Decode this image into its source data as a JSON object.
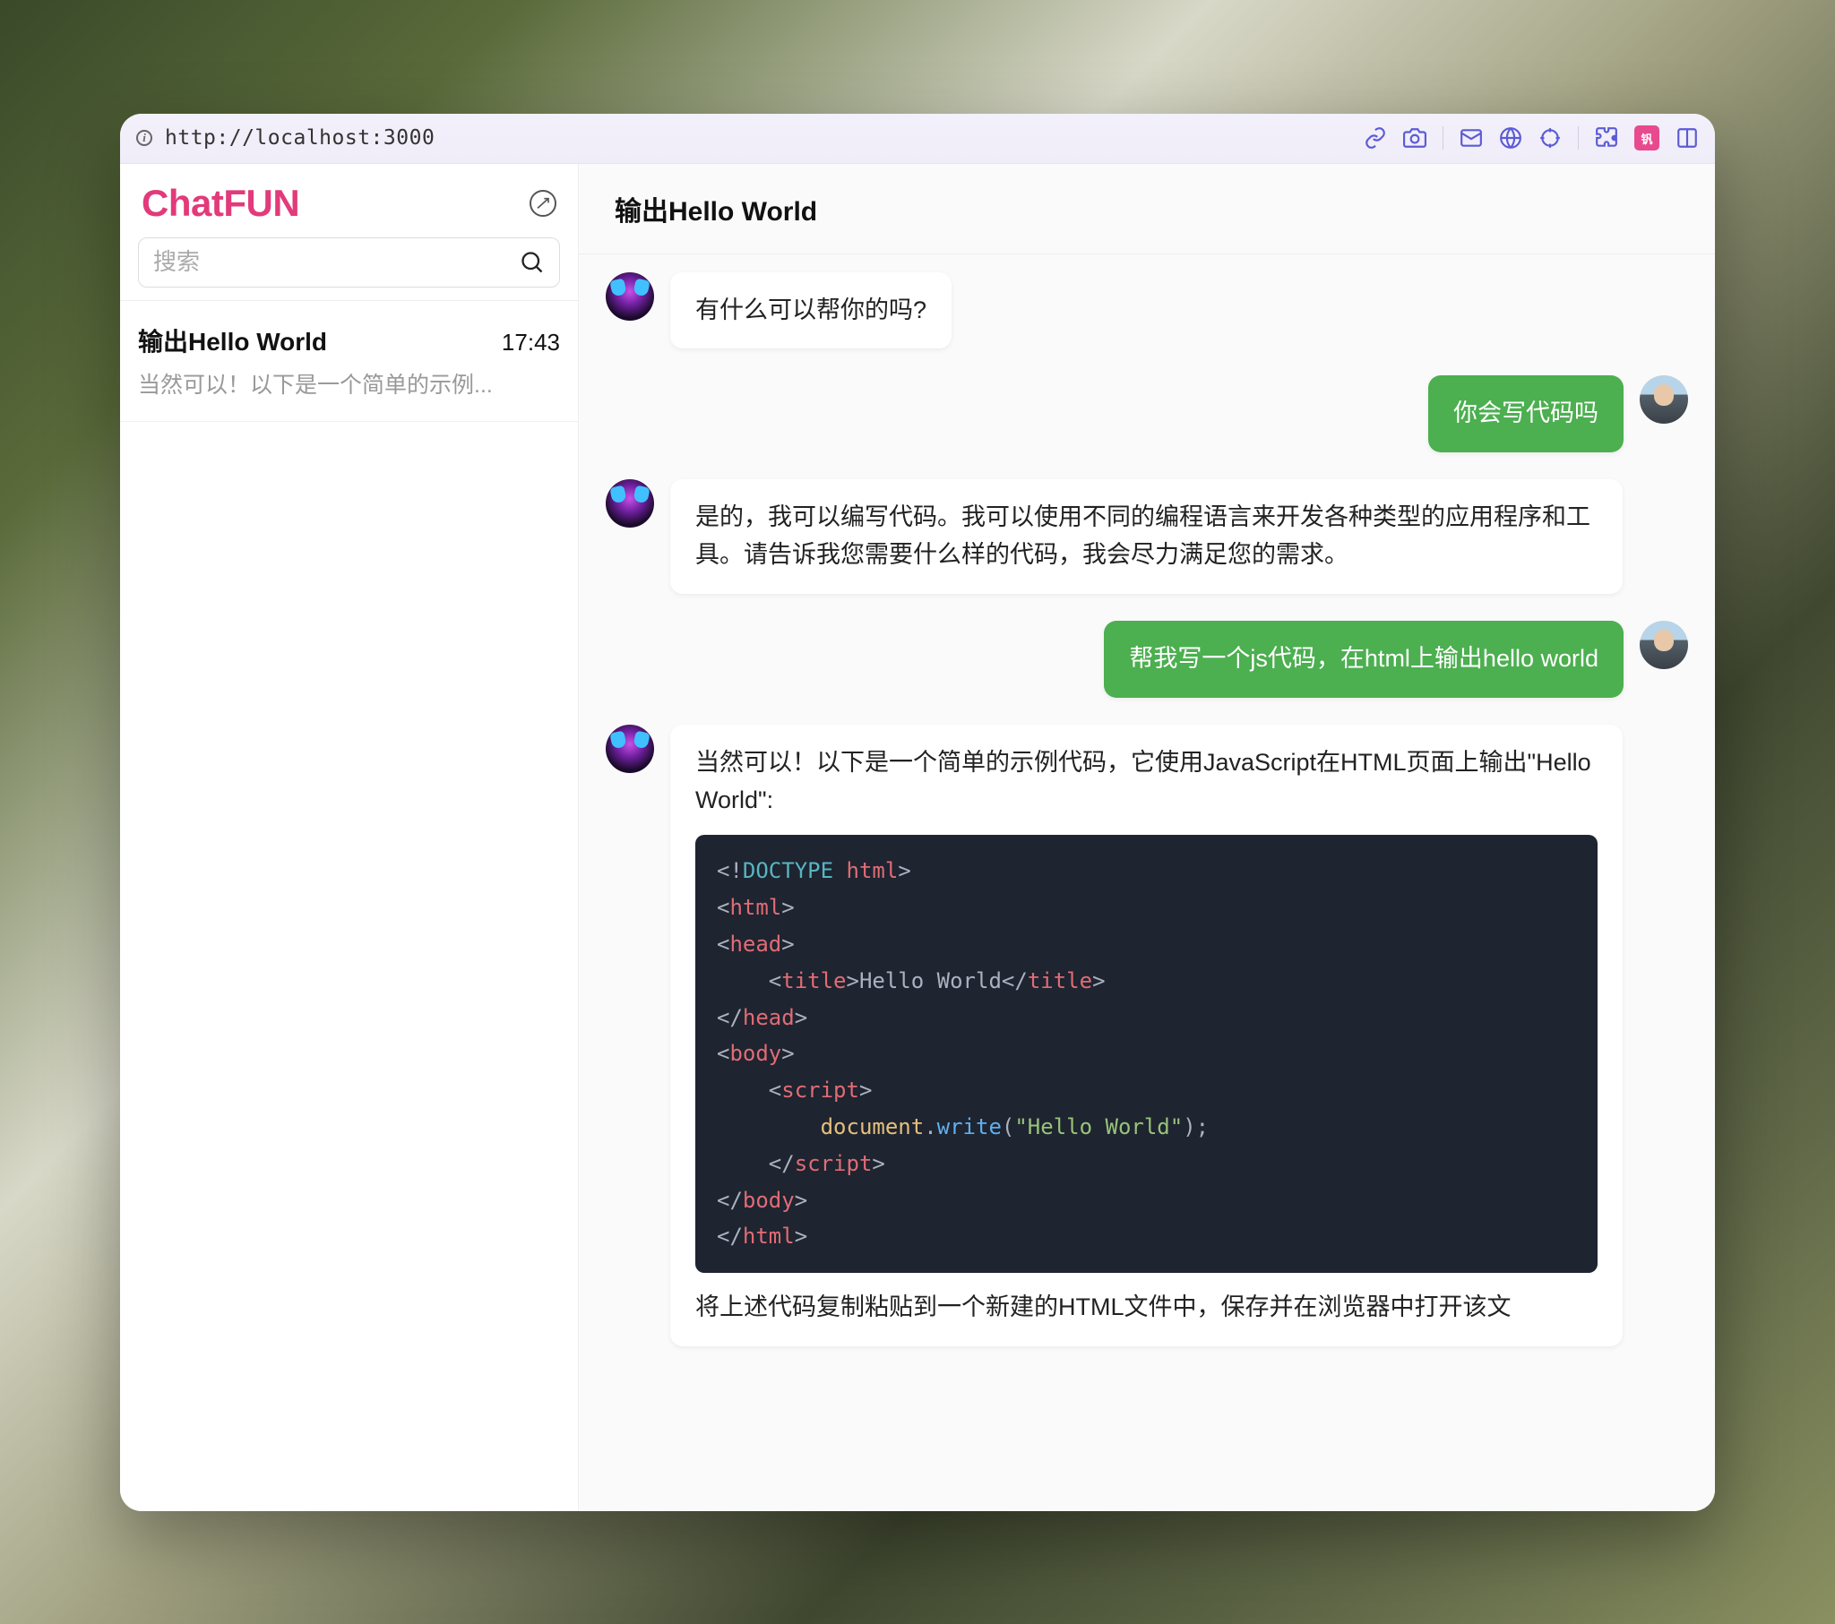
{
  "addressbar": {
    "url": "http://localhost:3000"
  },
  "sidebar": {
    "logo": "ChatFUN",
    "search_placeholder": "搜索",
    "conversations": [
      {
        "title": "输出Hello World",
        "time": "17:43",
        "preview": "当然可以！以下是一个简单的示例..."
      }
    ]
  },
  "chat": {
    "title": "输出Hello World",
    "messages": [
      {
        "role": "bot",
        "text": "有什么可以帮你的吗?"
      },
      {
        "role": "user",
        "text": "你会写代码吗"
      },
      {
        "role": "bot",
        "text": "是的，我可以编写代码。我可以使用不同的编程语言来开发各种类型的应用程序和工具。请告诉我您需要什么样的代码，我会尽力满足您的需求。"
      },
      {
        "role": "user",
        "text": "帮我写一个js代码，在html上输出hello world"
      },
      {
        "role": "bot",
        "intro": "当然可以！以下是一个简单的示例代码，它使用JavaScript在HTML页面上输出\"Hello World\":",
        "code": {
          "lines": [
            {
              "indent": 0,
              "tokens": [
                [
                  "<!",
                  "punct"
                ],
                [
                  "DOCTYPE",
                  "doctype"
                ],
                [
                  " ",
                  "punct"
                ],
                [
                  "html",
                  "tag"
                ],
                [
                  ">",
                  "punct"
                ]
              ]
            },
            {
              "indent": 0,
              "tokens": [
                [
                  "<",
                  "punct"
                ],
                [
                  "html",
                  "tag"
                ],
                [
                  ">",
                  "punct"
                ]
              ]
            },
            {
              "indent": 0,
              "tokens": [
                [
                  "<",
                  "punct"
                ],
                [
                  "head",
                  "tag"
                ],
                [
                  ">",
                  "punct"
                ]
              ]
            },
            {
              "indent": 1,
              "tokens": [
                [
                  "<",
                  "punct"
                ],
                [
                  "title",
                  "tag"
                ],
                [
                  ">",
                  "punct"
                ],
                [
                  "Hello World",
                  "text"
                ],
                [
                  "</",
                  "punct"
                ],
                [
                  "title",
                  "tag"
                ],
                [
                  ">",
                  "punct"
                ]
              ]
            },
            {
              "indent": 0,
              "tokens": [
                [
                  "</",
                  "punct"
                ],
                [
                  "head",
                  "tag"
                ],
                [
                  ">",
                  "punct"
                ]
              ]
            },
            {
              "indent": 0,
              "tokens": [
                [
                  "<",
                  "punct"
                ],
                [
                  "body",
                  "tag"
                ],
                [
                  ">",
                  "punct"
                ]
              ]
            },
            {
              "indent": 1,
              "tokens": [
                [
                  "<",
                  "punct"
                ],
                [
                  "script",
                  "tag"
                ],
                [
                  ">",
                  "punct"
                ]
              ]
            },
            {
              "indent": 2,
              "tokens": [
                [
                  "document",
                  "obj"
                ],
                [
                  ".",
                  "punct"
                ],
                [
                  "write",
                  "method"
                ],
                [
                  "(",
                  "punct"
                ],
                [
                  "\"Hello World\"",
                  "string"
                ],
                [
                  ")",
                  "punct"
                ],
                [
                  ";",
                  "punct"
                ]
              ]
            },
            {
              "indent": 1,
              "tokens": [
                [
                  "</",
                  "punct"
                ],
                [
                  "script",
                  "tag"
                ],
                [
                  ">",
                  "punct"
                ]
              ]
            },
            {
              "indent": 0,
              "tokens": [
                [
                  "</",
                  "punct"
                ],
                [
                  "body",
                  "tag"
                ],
                [
                  ">",
                  "punct"
                ]
              ]
            },
            {
              "indent": 0,
              "tokens": [
                [
                  "</",
                  "punct"
                ],
                [
                  "html",
                  "tag"
                ],
                [
                  ">",
                  "punct"
                ]
              ]
            }
          ]
        },
        "outro": "将上述代码复制粘贴到一个新建的HTML文件中，保存并在浏览器中打开该文"
      }
    ]
  }
}
